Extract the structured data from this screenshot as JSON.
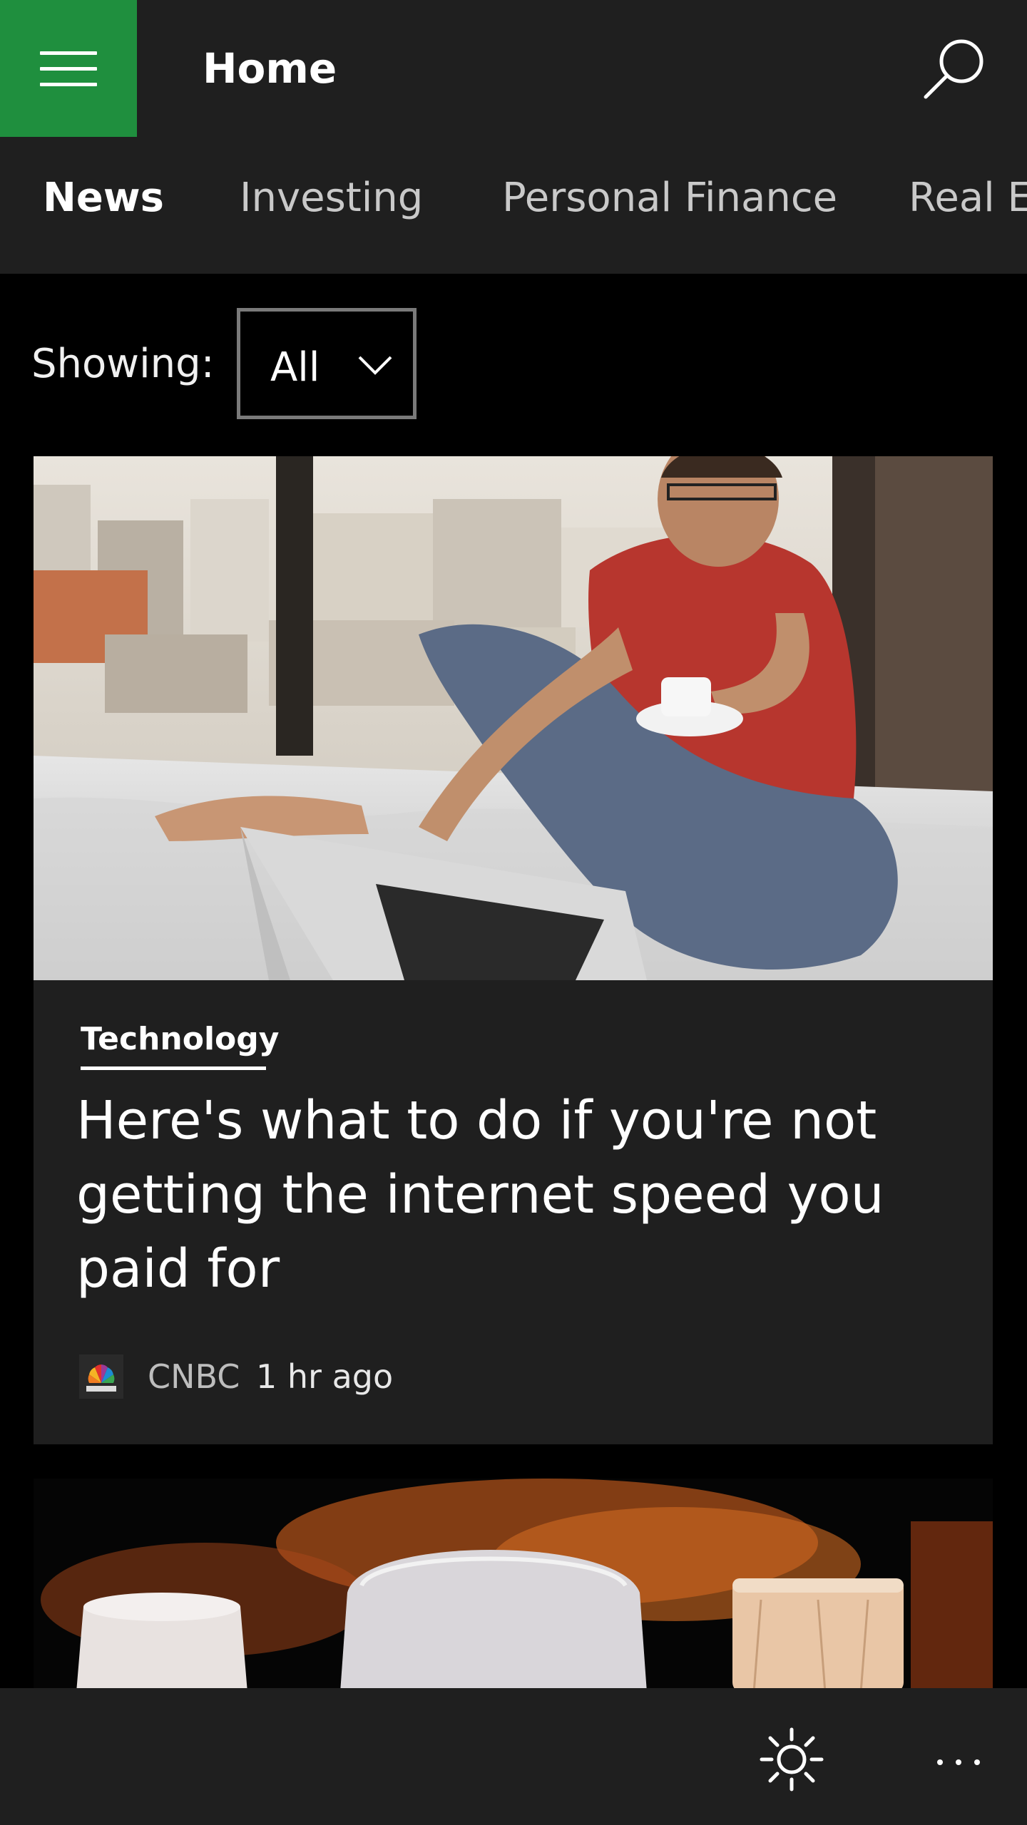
{
  "header": {
    "title": "Home",
    "accent_color": "#1f8f3e",
    "menu_icon": "hamburger-icon",
    "search_icon": "search-icon"
  },
  "tabs": [
    {
      "label": "News",
      "active": true
    },
    {
      "label": "Investing",
      "active": false
    },
    {
      "label": "Personal Finance",
      "active": false
    },
    {
      "label": "Real Es",
      "active": false
    }
  ],
  "filter": {
    "label": "Showing:",
    "selected": "All"
  },
  "articles": [
    {
      "category": "Technology",
      "headline": "Here's what to do if you're not getting the internet speed you paid for",
      "source": "CNBC",
      "time": "1 hr ago"
    }
  ],
  "appbar": {
    "theme_icon": "brightness-icon",
    "more_icon": "more-icon"
  }
}
